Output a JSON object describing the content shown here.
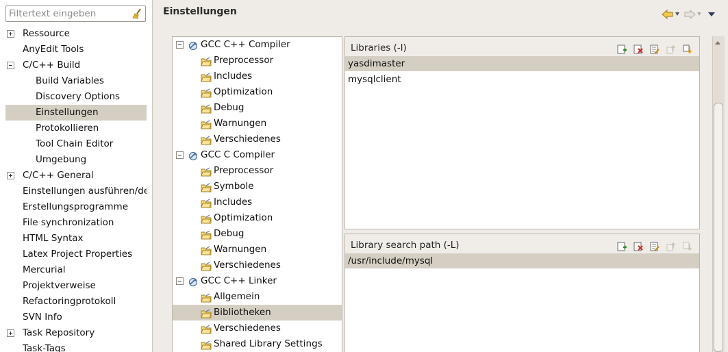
{
  "filter": {
    "placeholder": "Filtertext eingeben"
  },
  "nav": [
    {
      "label": "Ressource",
      "expander": "plus"
    },
    {
      "label": "AnyEdit Tools"
    },
    {
      "label": "C/C++ Build",
      "expander": "minus"
    },
    {
      "label": "Build Variables",
      "child": true
    },
    {
      "label": "Discovery Options",
      "child": true
    },
    {
      "label": "Einstellungen",
      "child": true,
      "selected": true
    },
    {
      "label": "Protokollieren",
      "child": true
    },
    {
      "label": "Tool Chain Editor",
      "child": true
    },
    {
      "label": "Umgebung",
      "child": true
    },
    {
      "label": "C/C++ General",
      "expander": "plus"
    },
    {
      "label": "Einstellungen ausführen/debuggen"
    },
    {
      "label": "Erstellungsprogramme"
    },
    {
      "label": "File synchronization"
    },
    {
      "label": "HTML Syntax"
    },
    {
      "label": "Latex Project Properties"
    },
    {
      "label": "Mercurial"
    },
    {
      "label": "Projektverweise"
    },
    {
      "label": "Refactoringprotokoll"
    },
    {
      "label": "SVN Info"
    },
    {
      "label": "Task Repository",
      "expander": "plus"
    },
    {
      "label": "Task-Tags"
    }
  ],
  "header": {
    "title": "Einstellungen",
    "back_icon": "arrow-left-icon",
    "forward_icon": "arrow-right-icon",
    "menu_icon": "view-menu-icon"
  },
  "tool_tree": [
    {
      "label": "GCC C++ Compiler",
      "level": 0,
      "icon": "tool-icon"
    },
    {
      "label": "Preprocessor",
      "level": 1,
      "icon": "folder-icon"
    },
    {
      "label": "Includes",
      "level": 1,
      "icon": "folder-icon"
    },
    {
      "label": "Optimization",
      "level": 1,
      "icon": "folder-icon"
    },
    {
      "label": "Debug",
      "level": 1,
      "icon": "folder-icon"
    },
    {
      "label": "Warnungen",
      "level": 1,
      "icon": "folder-icon"
    },
    {
      "label": "Verschiedenes",
      "level": 1,
      "icon": "folder-icon"
    },
    {
      "label": "GCC C Compiler",
      "level": 0,
      "icon": "tool-icon"
    },
    {
      "label": "Preprocessor",
      "level": 1,
      "icon": "folder-icon"
    },
    {
      "label": "Symbole",
      "level": 1,
      "icon": "folder-icon"
    },
    {
      "label": "Includes",
      "level": 1,
      "icon": "folder-icon"
    },
    {
      "label": "Optimization",
      "level": 1,
      "icon": "folder-icon"
    },
    {
      "label": "Debug",
      "level": 1,
      "icon": "folder-icon"
    },
    {
      "label": "Warnungen",
      "level": 1,
      "icon": "folder-icon"
    },
    {
      "label": "Verschiedenes",
      "level": 1,
      "icon": "folder-icon"
    },
    {
      "label": "GCC C++ Linker",
      "level": 0,
      "icon": "tool-icon"
    },
    {
      "label": "Allgemein",
      "level": 1,
      "icon": "folder-icon"
    },
    {
      "label": "Bibliotheken",
      "level": 1,
      "icon": "folder-icon",
      "selected": true
    },
    {
      "label": "Verschiedenes",
      "level": 1,
      "icon": "folder-icon"
    },
    {
      "label": "Shared Library Settings",
      "level": 1,
      "icon": "folder-icon"
    }
  ],
  "libraries": {
    "title": "Libraries (-l)",
    "items": [
      {
        "value": "yasdimaster",
        "selected": true
      },
      {
        "value": "mysqlclient"
      }
    ]
  },
  "library_paths": {
    "title": "Library search path (-L)",
    "items": [
      {
        "value": "/usr/include/mysql",
        "selected": true
      }
    ]
  },
  "toolbar_icons": [
    "add-icon",
    "delete-icon",
    "edit-icon",
    "move-up-icon",
    "move-down-icon"
  ],
  "colors": {
    "selection": "#d5cec3",
    "background": "#efebe7",
    "accent_arrow": "#e8a317"
  }
}
